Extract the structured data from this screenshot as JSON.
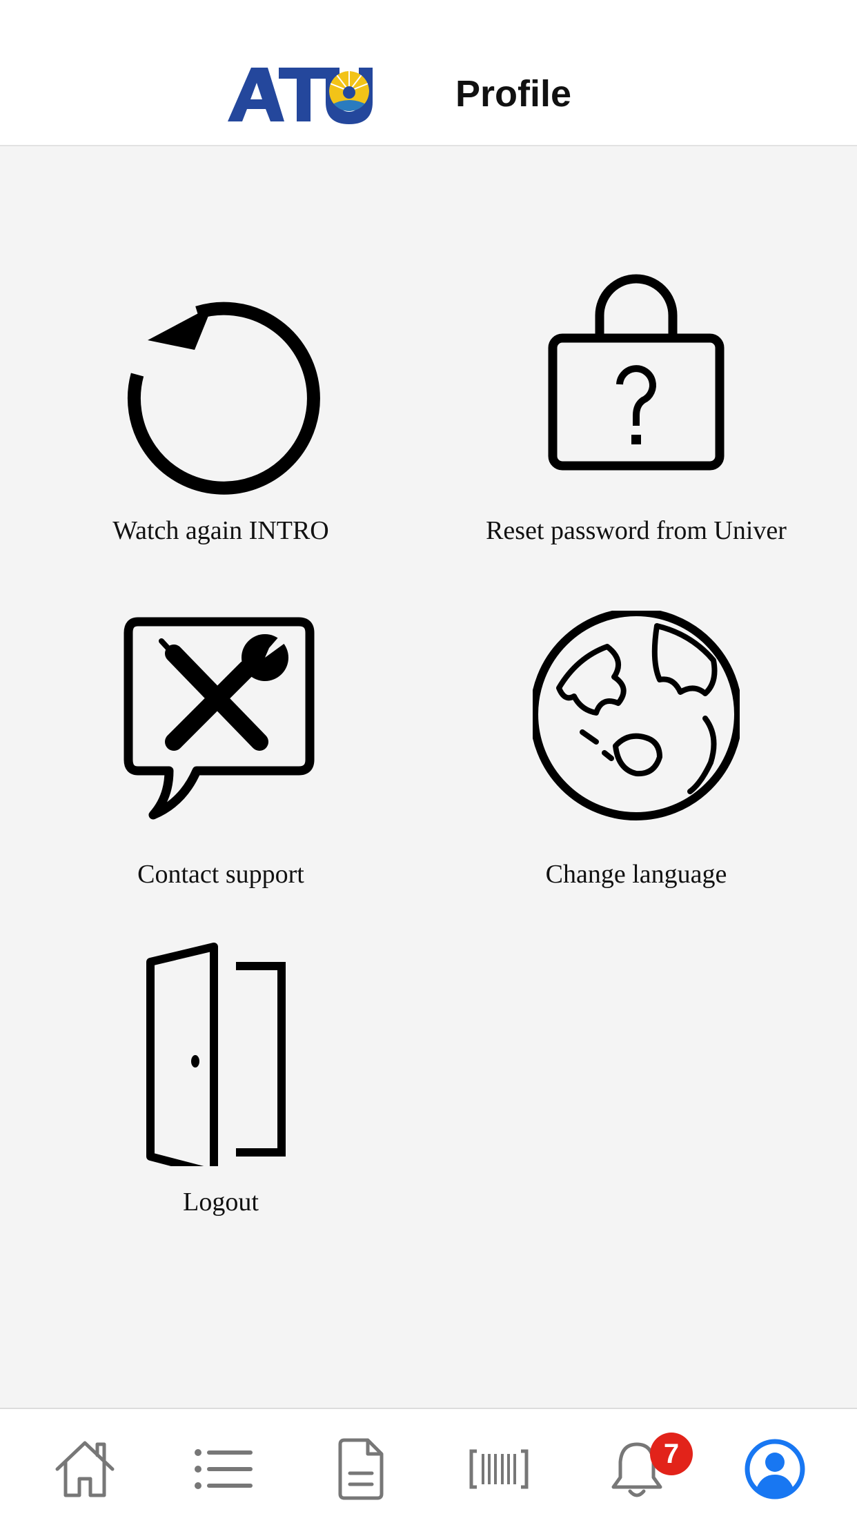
{
  "header": {
    "logo_text": "ATU",
    "title": "Profile"
  },
  "menu": {
    "items": [
      {
        "label": "Watch again INTRO",
        "icon": "replay-icon"
      },
      {
        "label": "Reset password from Univer",
        "icon": "lock-question-icon"
      },
      {
        "label": "Contact support",
        "icon": "support-tools-icon"
      },
      {
        "label": "Change language",
        "icon": "globe-icon"
      },
      {
        "label": "Logout",
        "icon": "door-icon"
      }
    ]
  },
  "tabbar": {
    "tabs": [
      {
        "name": "home",
        "icon": "home-icon"
      },
      {
        "name": "list",
        "icon": "list-icon"
      },
      {
        "name": "documents",
        "icon": "document-icon"
      },
      {
        "name": "barcode",
        "icon": "barcode-icon"
      },
      {
        "name": "notifications",
        "icon": "bell-icon",
        "badge": "7"
      },
      {
        "name": "profile",
        "icon": "profile-icon",
        "active": true
      }
    ],
    "active_color": "#1877f2",
    "inactive_color": "#777777",
    "badge_color": "#e2231a"
  },
  "colors": {
    "logo_blue": "#24479c",
    "logo_gold": "#f2c318",
    "background": "#f4f4f4"
  }
}
